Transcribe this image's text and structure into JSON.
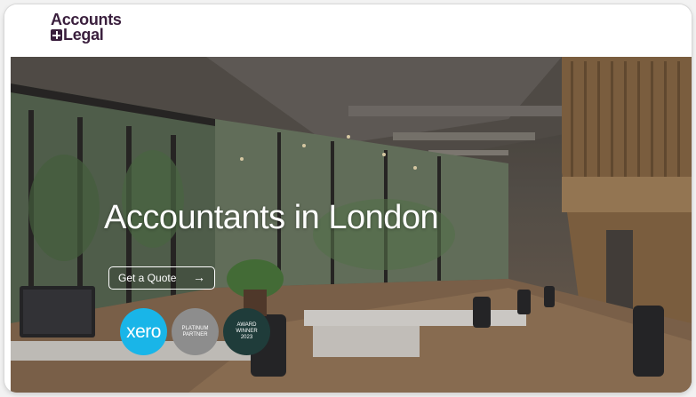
{
  "header": {
    "logo_line1": "Accounts",
    "logo_line2": "Legal"
  },
  "hero": {
    "title": "Accountants in London",
    "cta_label": "Get a Quote",
    "cta_arrow": "→"
  },
  "badges": {
    "xero": "xero",
    "platinum_line1": "PLATINUM",
    "platinum_line2": "PARTNER",
    "award_line1": "AWARD",
    "award_line2": "WINNER",
    "award_line3": "2023"
  },
  "colors": {
    "brand": "#3a1f3d",
    "xero": "#19b5e8",
    "platinum": "#8d8d8d",
    "award": "#1f3c3a"
  }
}
